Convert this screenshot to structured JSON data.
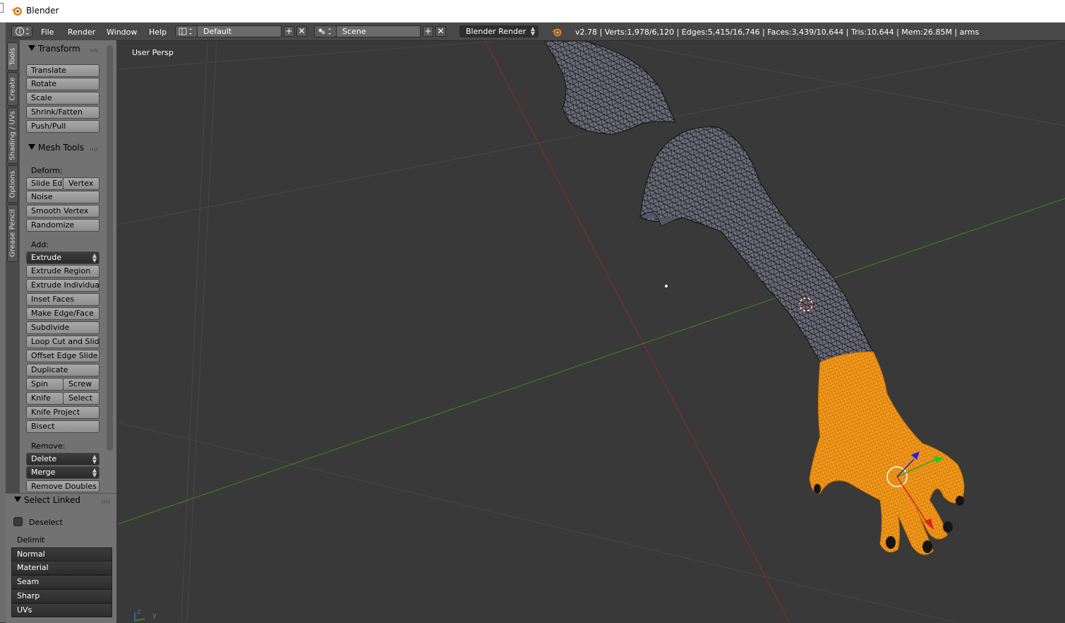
{
  "window": {
    "title": "Blender"
  },
  "infobar": {
    "menus": [
      "File",
      "Render",
      "Window",
      "Help"
    ],
    "layout": "Default",
    "scene": "Scene",
    "engine": "Blender Render",
    "stats": "v2.78 | Verts:1,978/6,120 | Edges:5,415/16,746 | Faces:3,439/10,644 | Tris:10,644 | Mem:26.85M | arms"
  },
  "tabs": [
    "Tools",
    "Create",
    "Shading / UVs",
    "Options",
    "Grease Pencil"
  ],
  "transform": {
    "title": "Transform",
    "buttons": [
      "Translate",
      "Rotate",
      "Scale",
      "Shrink/Fatten",
      "Push/Pull"
    ]
  },
  "mesh_tools": {
    "title": "Mesh Tools",
    "deform_label": "Deform:",
    "slide_edge": "Slide Ed",
    "vertex": "Vertex",
    "noise": "Noise",
    "smooth_vertex": "Smooth Vertex",
    "randomize": "Randomize",
    "add_label": "Add:",
    "extrude": "Extrude",
    "extrude_region": "Extrude Region",
    "extrude_individual": "Extrude Individual",
    "inset_faces": "Inset Faces",
    "make_edge_face": "Make Edge/Face",
    "subdivide": "Subdivide",
    "loop_cut": "Loop Cut and Slide",
    "offset_edge": "Offset Edge Slide",
    "duplicate": "Duplicate",
    "spin": "Spin",
    "screw": "Screw",
    "knife": "Knife",
    "select": "Select",
    "knife_project": "Knife Project",
    "bisect": "Bisect",
    "remove_label": "Remove:",
    "delete": "Delete",
    "merge": "Merge",
    "remove_doubles": "Remove Doubles"
  },
  "select_linked": {
    "title": "Select Linked",
    "deselect": "Deselect",
    "delimit_label": "Delimit",
    "options": [
      "Normal",
      "Material",
      "Seam",
      "Sharp",
      "UVs"
    ]
  },
  "viewport": {
    "view_label": "User Persp",
    "mesh_color": "#6a6a78",
    "selected_color": "#f39a1e",
    "x_axis_color": "#8a2b2b",
    "y_axis_color": "#3a8a1a",
    "axis_labels": [
      "z",
      "y"
    ]
  }
}
